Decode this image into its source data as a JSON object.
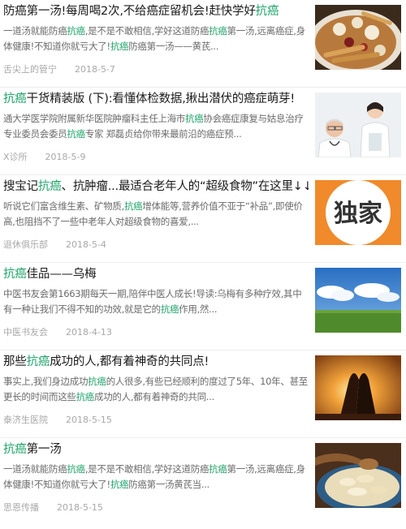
{
  "feed": {
    "items": [
      {
        "title_parts": [
          [
            "",
            "防癌第一汤!每周喝2次,不给癌症留机会!赶快学好"
          ],
          [
            "hl",
            "抗癌"
          ]
        ],
        "summary_parts": [
          [
            "",
            "一道汤就能防癌"
          ],
          [
            "hl",
            "抗癌"
          ],
          [
            "",
            ",是不是不敢相信,学好这道防癌"
          ],
          [
            "hl",
            "抗癌"
          ],
          [
            "",
            "第一汤,远离癌症,身体健康!不知道你就亏大了!"
          ],
          [
            "hl",
            "抗癌"
          ],
          [
            "",
            "防癌第一汤——黄芪..."
          ]
        ],
        "source": "舌尖上的管宁",
        "date": "2018-5-7",
        "image": "herbal-soup-bowl"
      },
      {
        "title_parts": [
          [
            "hl",
            "抗癌"
          ],
          [
            "",
            "干货精装版 (下):看懂体检数据,揪出潜伏的癌症萌芽!"
          ]
        ],
        "summary_parts": [
          [
            "",
            "通大学医学院附属新华医院肿瘤科主任上海市"
          ],
          [
            "hl",
            "抗癌"
          ],
          [
            "",
            "协会癌症康复与姑息治疗专业委员会委员"
          ],
          [
            "hl",
            "抗癌"
          ],
          [
            "",
            "专家 郑磊贞给你带来最前沿的癌症预..."
          ]
        ],
        "source": "X诊所",
        "date": "2018-5-9",
        "image": "doctors-photo"
      },
      {
        "title_parts": [
          [
            "",
            "搜宝记"
          ],
          [
            "hl",
            "抗癌"
          ],
          [
            "",
            "、抗肿瘤...最适合老年人的“超级食物”在这里↓↓↓"
          ]
        ],
        "summary_parts": [
          [
            "",
            "听说它们富含维生素、矿物质,"
          ],
          [
            "hl",
            "抗癌"
          ],
          [
            "",
            "增体能等,营养价值不亚于“补品”,即使价高,也阻挡不了一些中老年人对超级食物的喜爱,..."
          ]
        ],
        "source": "退休俱乐部",
        "date": "2018-5-4",
        "image": "exclusive-badge",
        "image_text": "独家"
      },
      {
        "title_parts": [
          [
            "hl",
            "抗癌"
          ],
          [
            "",
            "佳品——乌梅"
          ]
        ],
        "summary_parts": [
          [
            "",
            "中医书友会第1663期每天一期,陪伴中医人成长!导读:乌梅有多种疗效,其中有一种让我们不得不知的功效,就是它的"
          ],
          [
            "hl",
            "抗癌"
          ],
          [
            "",
            "作用,然..."
          ]
        ],
        "source": "中医书友会",
        "date": "2018-4-13",
        "image": "sky-landscape"
      },
      {
        "title_parts": [
          [
            "",
            "那些"
          ],
          [
            "hl",
            "抗癌"
          ],
          [
            "",
            "成功的人,都有着神奇的共同点!"
          ]
        ],
        "summary_parts": [
          [
            "",
            "事实上,我们身边成功"
          ],
          [
            "hl",
            "抗癌"
          ],
          [
            "",
            "的人很多,有些已经顺利的度过了5年、10年、甚至更长的时间而这些"
          ],
          [
            "hl",
            "抗癌"
          ],
          [
            "",
            "成功的人,都有着神奇的共同..."
          ]
        ],
        "source": "泰济生医院",
        "date": "2018-5-15",
        "image": "praying-hands-sunset"
      },
      {
        "title_parts": [
          [
            "hl",
            "抗癌"
          ],
          [
            "",
            "第一汤"
          ]
        ],
        "summary_parts": [
          [
            "",
            "一道汤就能防癌"
          ],
          [
            "hl",
            "抗癌"
          ],
          [
            "",
            ",是不是不敢相信,学好这道防癌"
          ],
          [
            "hl",
            "抗癌"
          ],
          [
            "",
            "第一汤,远离癌症,身体健康!不知道你就亏大了!"
          ],
          [
            "hl",
            "抗癌"
          ],
          [
            "",
            "防癌第一汤黄芪当..."
          ]
        ],
        "source": "思恩传播",
        "date": "2018-5-15",
        "image": "astragalus-slices"
      }
    ]
  },
  "colors": {
    "highlight": "#21a56b",
    "meta": "#a8a8a8",
    "summary": "#6b6b6b",
    "badge": "#f08a2a"
  }
}
